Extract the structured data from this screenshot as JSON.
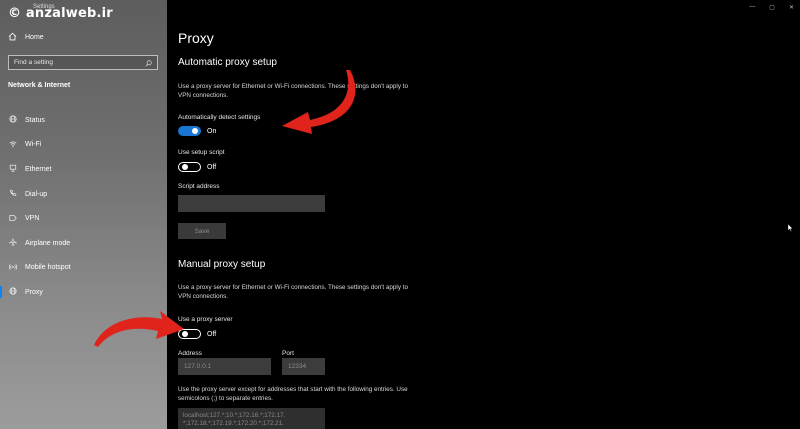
{
  "watermark": "© anzalweb.ir",
  "app_title": "Settings",
  "window_controls": [
    "—",
    "▢",
    "✕"
  ],
  "sidebar": {
    "home_label": "Home",
    "search_placeholder": "Find a setting",
    "section_heading": "Network & Internet",
    "items": [
      {
        "label": "Status",
        "icon": "globe-icon"
      },
      {
        "label": "Wi-Fi",
        "icon": "wifi-icon"
      },
      {
        "label": "Ethernet",
        "icon": "ethernet-icon"
      },
      {
        "label": "Dial-up",
        "icon": "phone-icon"
      },
      {
        "label": "VPN",
        "icon": "vpn-icon"
      },
      {
        "label": "Airplane mode",
        "icon": "airplane-icon"
      },
      {
        "label": "Mobile hotspot",
        "icon": "hotspot-icon"
      },
      {
        "label": "Proxy",
        "icon": "globe-icon"
      }
    ],
    "active_item": "Proxy"
  },
  "main": {
    "title": "Proxy",
    "auto": {
      "heading": "Automatic proxy setup",
      "description": "Use a proxy server for Ethernet or Wi-Fi connections. These settings don't apply to VPN connections.",
      "detect_label": "Automatically detect settings",
      "detect_state": "On",
      "script_toggle_label": "Use setup script",
      "script_state": "Off",
      "script_address_label": "Script address",
      "script_address_value": "",
      "save_label": "Save"
    },
    "manual": {
      "heading": "Manual proxy setup",
      "description": "Use a proxy server for Ethernet or Wi-Fi connections. These settings don't apply to VPN connections.",
      "proxy_label": "Use a proxy server",
      "proxy_state": "Off",
      "address_label": "Address",
      "address_placeholder": "127.0.0.1",
      "port_label": "Port",
      "port_placeholder": "12334",
      "exceptions_description": "Use the proxy server except for addresses that start with the following entries. Use semicolons (;) to separate entries.",
      "exceptions_value": "localhost;127.*;10.*;172.16.*;172.17.\n*;172.18.*;172.19.*;172.20.*;172.21."
    }
  },
  "colors": {
    "toggle_on": "#1976d2",
    "arrow": "#e0241b",
    "accent": "#0a84ff"
  }
}
